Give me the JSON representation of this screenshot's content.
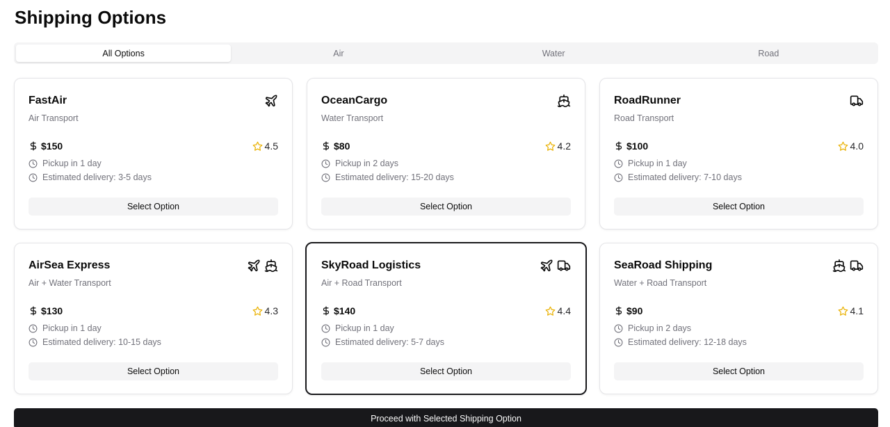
{
  "page": {
    "title": "Shipping Options"
  },
  "tabs": [
    {
      "label": "All Options",
      "active": true
    },
    {
      "label": "Air",
      "active": false
    },
    {
      "label": "Water",
      "active": false
    },
    {
      "label": "Road",
      "active": false
    }
  ],
  "options": [
    {
      "name": "FastAir",
      "type": "Air Transport",
      "icons": [
        "plane-icon"
      ],
      "price": "$150",
      "rating": "4.5",
      "pickup": "Pickup in 1 day",
      "delivery": "Estimated delivery: 3-5 days",
      "button": "Select Option",
      "selected": false
    },
    {
      "name": "OceanCargo",
      "type": "Water Transport",
      "icons": [
        "ship-icon"
      ],
      "price": "$80",
      "rating": "4.2",
      "pickup": "Pickup in 2 days",
      "delivery": "Estimated delivery: 15-20 days",
      "button": "Select Option",
      "selected": false
    },
    {
      "name": "RoadRunner",
      "type": "Road Transport",
      "icons": [
        "truck-icon"
      ],
      "price": "$100",
      "rating": "4.0",
      "pickup": "Pickup in 1 day",
      "delivery": "Estimated delivery: 7-10 days",
      "button": "Select Option",
      "selected": false
    },
    {
      "name": "AirSea Express",
      "type": "Air + Water Transport",
      "icons": [
        "plane-icon",
        "ship-icon"
      ],
      "price": "$130",
      "rating": "4.3",
      "pickup": "Pickup in 1 day",
      "delivery": "Estimated delivery: 10-15 days",
      "button": "Select Option",
      "selected": false
    },
    {
      "name": "SkyRoad Logistics",
      "type": "Air + Road Transport",
      "icons": [
        "plane-icon",
        "truck-icon"
      ],
      "price": "$140",
      "rating": "4.4",
      "pickup": "Pickup in 1 day",
      "delivery": "Estimated delivery: 5-7 days",
      "button": "Select Option",
      "selected": true
    },
    {
      "name": "SeaRoad Shipping",
      "type": "Water + Road Transport",
      "icons": [
        "ship-icon",
        "truck-icon"
      ],
      "price": "$90",
      "rating": "4.1",
      "pickup": "Pickup in 2 days",
      "delivery": "Estimated delivery: 12-18 days",
      "button": "Select Option",
      "selected": false
    }
  ],
  "proceed": {
    "label": "Proceed with Selected Shipping Option"
  },
  "colors": {
    "star": "#eab308",
    "accent": "#18181b",
    "muted": "#71717a"
  }
}
